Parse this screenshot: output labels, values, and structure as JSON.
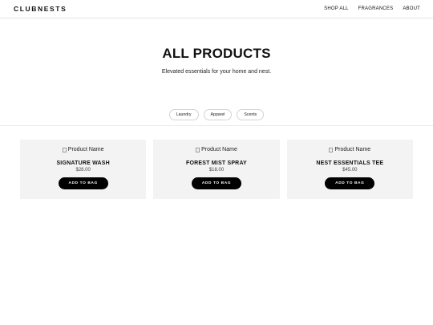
{
  "header": {
    "logo": "CLUBNESTS",
    "nav": [
      "SHOP ALL",
      "FRAGRANCES",
      "ABOUT"
    ]
  },
  "hero": {
    "title": "ALL PRODUCTS",
    "subtitle": "Elevated essentials for your home and nest."
  },
  "filters": [
    "Laundry",
    "Apparel",
    "Scents"
  ],
  "products": [
    {
      "image_alt": "Product Name",
      "name": "SIGNATURE WASH",
      "price": "$28.00",
      "button": "ADD TO BAG"
    },
    {
      "image_alt": "Product Name",
      "name": "FOREST MIST SPRAY",
      "price": "$18.00",
      "button": "ADD TO BAG"
    },
    {
      "image_alt": "Product Name",
      "name": "NEST ESSENTIALS TEE",
      "price": "$45.00",
      "button": "ADD TO BAG"
    }
  ]
}
